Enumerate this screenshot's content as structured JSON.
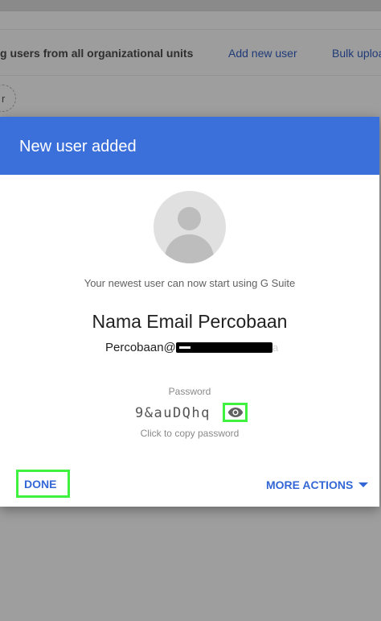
{
  "background": {
    "filter_text": "g users from all organizational units",
    "add_user_link": "Add new user",
    "bulk_link": "Bulk uploa",
    "filter_chip_text": "r"
  },
  "dialog": {
    "title": "New user added",
    "message": "Your newest user can now start using G Suite",
    "user_first_name": "Nama Email",
    "user_last_name": "Percobaan",
    "email_prefix": "Percobaan@",
    "email_tail": "a",
    "password_label": "Password",
    "password_value": "9&auDQhq",
    "copy_hint": "Click to copy password",
    "done_label": "DONE",
    "more_actions_label": "MORE ACTIONS"
  },
  "colors": {
    "header_blue": "#3b6fd9",
    "action_blue": "#3367d6",
    "highlight_green": "#3ff23f"
  },
  "icons": {
    "show_password": "eye-icon",
    "more_actions": "caret-down-icon",
    "avatar": "person-placeholder-icon"
  }
}
